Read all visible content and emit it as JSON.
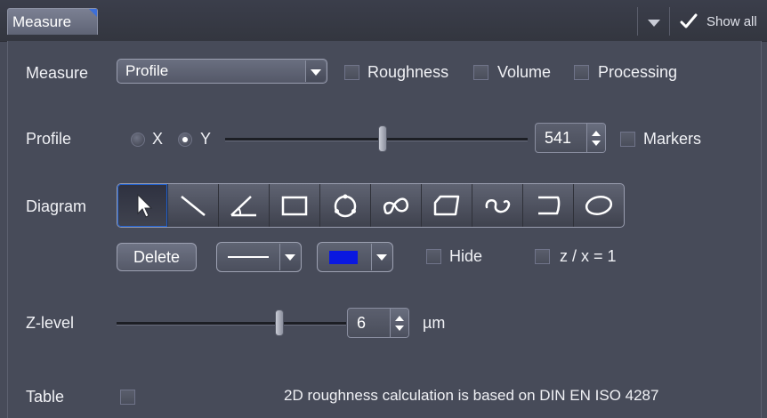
{
  "header": {
    "tab_label": "Measure",
    "show_all_label": "Show all"
  },
  "measure": {
    "label": "Measure",
    "mode_value": "Profile",
    "options": [
      {
        "label": "Roughness",
        "checked": false
      },
      {
        "label": "Volume",
        "checked": false
      },
      {
        "label": "Processing",
        "checked": false
      }
    ]
  },
  "profile": {
    "label": "Profile",
    "axis_options": [
      {
        "label": "X",
        "selected": false
      },
      {
        "label": "Y",
        "selected": true
      }
    ],
    "slider_fraction": 0.52,
    "position_value": "541",
    "markers_label": "Markers",
    "markers_checked": false
  },
  "diagram": {
    "label": "Diagram",
    "tools": [
      {
        "icon": "pointer-arrow-icon",
        "active": true
      },
      {
        "icon": "line-tool-icon"
      },
      {
        "icon": "angle-tool-icon"
      },
      {
        "icon": "rectangle-tool-icon"
      },
      {
        "icon": "circle-rotate-tool-icon"
      },
      {
        "icon": "curve-loop-tool-icon"
      },
      {
        "icon": "polygon-tool-icon"
      },
      {
        "icon": "spline-tool-icon"
      },
      {
        "icon": "open-shape-tool-icon"
      },
      {
        "icon": "ellipse-tool-icon"
      }
    ],
    "delete_label": "Delete",
    "color_swatch": "#0a18e0",
    "hide_label": "Hide",
    "hide_checked": false,
    "ratio_label": "z / x = 1",
    "ratio_checked": false
  },
  "zlevel": {
    "label": "Z-level",
    "slider_fraction": 0.71,
    "value": "6",
    "unit": "µm"
  },
  "table": {
    "label": "Table",
    "checked": false,
    "note": "2D roughness calculation is based on DIN EN ISO 4287"
  },
  "colors": {
    "background": "#474b59",
    "header": "#33363f",
    "accent": "#3d6fd8"
  }
}
